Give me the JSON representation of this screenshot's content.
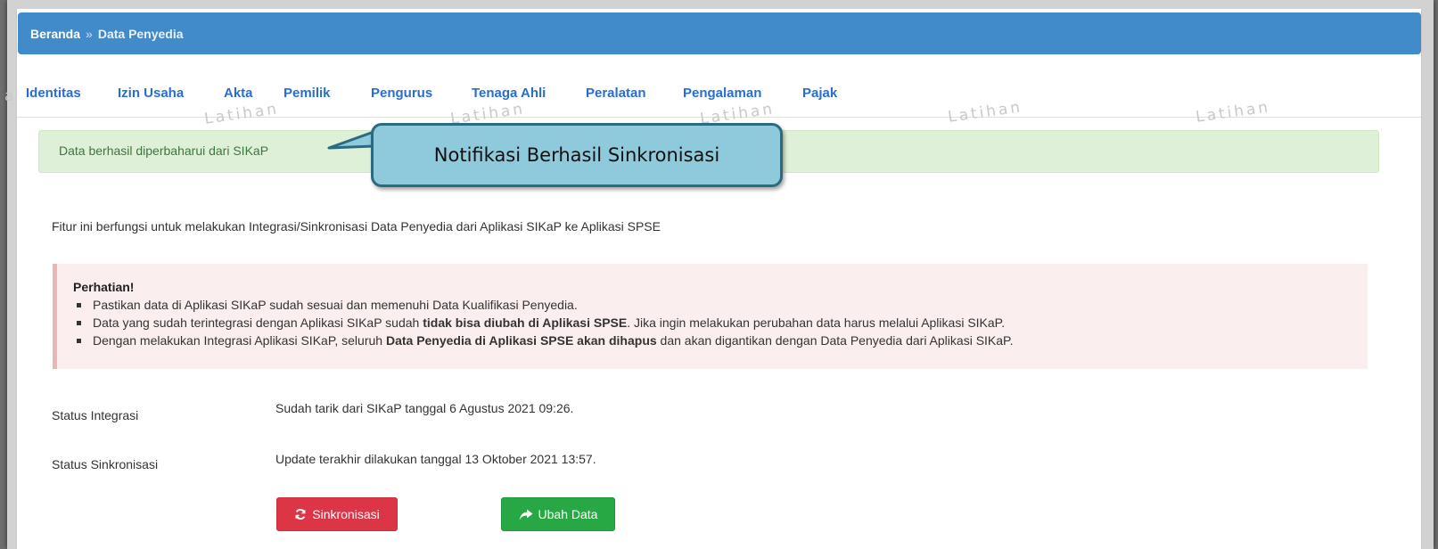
{
  "breadcrumb": {
    "home": "Beranda",
    "separator": "»",
    "current": "Data Penyedia"
  },
  "tabs": [
    {
      "label": "Identitas"
    },
    {
      "label": "Izin Usaha"
    },
    {
      "label": "Akta"
    },
    {
      "label": "Pemilik"
    },
    {
      "label": "Pengurus"
    },
    {
      "label": "Tenaga Ahli"
    },
    {
      "label": "Peralatan"
    },
    {
      "label": "Pengalaman"
    },
    {
      "label": "Pajak"
    }
  ],
  "watermark": {
    "text": "Latihan",
    "edge_text": "a"
  },
  "alert": {
    "message": "Data berhasil diperbaharui dari SIKaP",
    "color": "#dff0d8"
  },
  "callout": {
    "text": "Notifikasi Berhasil Sinkronisasi",
    "color": "#8ec9dc"
  },
  "intro": "Fitur ini berfungsi untuk melakukan Integrasi/Sinkronisasi Data Penyedia dari Aplikasi SIKaP ke Aplikasi SPSE",
  "warning": {
    "title": "Perhatian!",
    "item1": "Pastikan data di Aplikasi SIKaP sudah sesuai dan memenuhi Data Kualifikasi Penyedia.",
    "item2_pre": "Data yang sudah terintegrasi dengan Aplikasi SIKaP sudah ",
    "item2_bold": "tidak bisa diubah di Aplikasi SPSE",
    "item2_post": ". Jika ingin melakukan perubahan data harus melalui Aplikasi SIKaP.",
    "item3_pre": "Dengan melakukan Integrasi Aplikasi SIKaP, seluruh ",
    "item3_bold": "Data Penyedia di Aplikasi SPSE akan dihapus",
    "item3_post": " dan akan digantikan dengan Data Penyedia dari Aplikasi SIKaP."
  },
  "status": {
    "integrasi_label": "Status Integrasi",
    "integrasi_value": "Sudah tarik dari SIKaP tanggal 6 Agustus 2021 09:26.",
    "sinkronisasi_label": "Status Sinkronisasi",
    "sinkronisasi_value": "Update terakhir dilakukan tanggal 13 Oktober 2021 13:57."
  },
  "buttons": {
    "sync_label": "Sinkronisasi",
    "sync_icon": "refresh-icon",
    "sync_color": "#dc3545",
    "edit_label": "Ubah Data",
    "edit_icon": "share-arrow-icon",
    "edit_color": "#28a745"
  },
  "colors": {
    "header": "#428bca",
    "tab_link": "#2a6dd0"
  }
}
